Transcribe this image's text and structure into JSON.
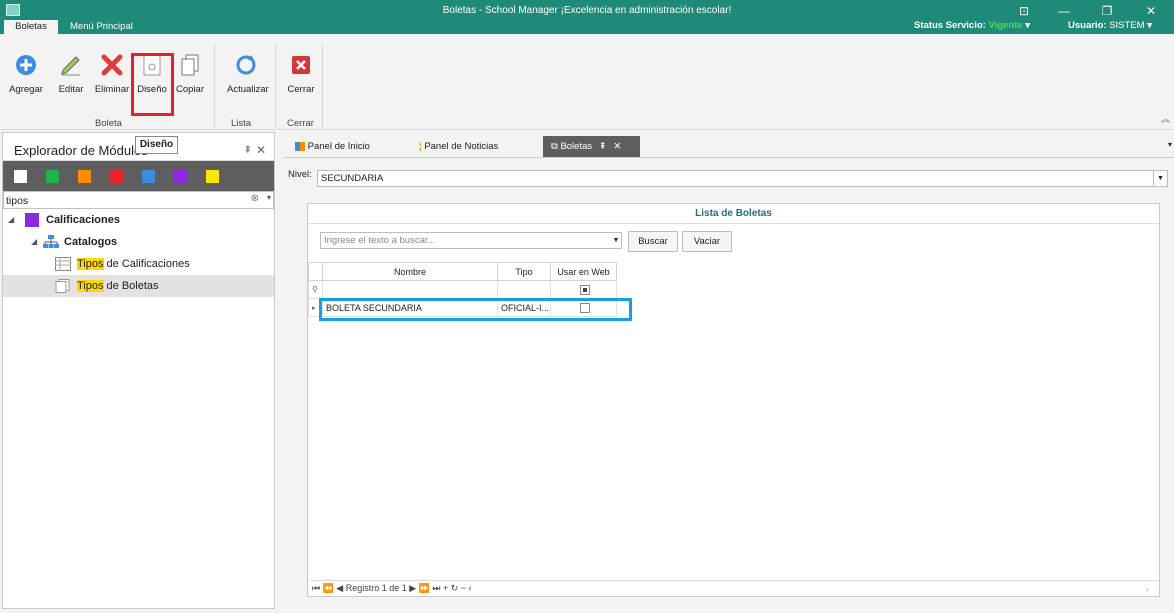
{
  "window": {
    "title": "Boletas - School Manager ¡Excelencia en administración escolar!",
    "tabs": [
      "Boletas",
      "Menú Principal"
    ],
    "status_label": "Status Servicio:",
    "status_value": "Vigente",
    "user_label": "Usuario:",
    "user_value": "SISTEM",
    "btn_restore": "⊡",
    "btn_min": "—",
    "btn_max": "❐",
    "btn_close": "✕"
  },
  "ribbon": {
    "buttons": [
      "Agregar",
      "Editar",
      "Eliminar",
      "Diseño",
      "Copiar",
      "Actualizar",
      "Cerrar"
    ],
    "groups": [
      "Boleta",
      "Lista",
      "Cerrar"
    ],
    "tooltip": "Diseño"
  },
  "explorer": {
    "title": "Explorador de Módulos",
    "colors": [
      "#ffffff",
      "#22b14c",
      "#ff8c00",
      "#e8202a",
      "#3e8ce0",
      "#8a2be2",
      "#ffe600"
    ],
    "search_value": "tipos",
    "tree": {
      "root": "Calificaciones",
      "root_color": "#8a2be2",
      "catalog": "Catalogos",
      "item1_hl": "Tipos",
      "item1_rest": " de Calificaciones",
      "item2_hl": "Tipos",
      "item2_rest": " de Boletas"
    }
  },
  "doc_tabs": [
    "Panel de Inicio",
    "Panel de Noticias",
    "Boletas"
  ],
  "main": {
    "nivel_label": "Nivel:",
    "nivel_value": "SECUNDARIA",
    "grid_title": "Lista de Boletas",
    "search_placeholder": "Ingrese el texto a buscar...",
    "buscar": "Buscar",
    "vaciar": "Vaciar",
    "columns": [
      "Nombre",
      "Tipo",
      "Usar en Web"
    ],
    "rows": [
      {
        "nombre": "BOLETA SECUNDARIA",
        "tipo": "OFICIAL-I...",
        "usar_en_web": false
      }
    ],
    "navigator": "⏮ ⏪ ◀  Registro 1 de 1  ▶ ⏩ ⏭ + ↻ − ‹"
  },
  "colors": {
    "titlebar": "#1f8a78",
    "highlight_red": "#e2222a",
    "highlight_blue": "#17a0e0",
    "search_hl": "#ffd800"
  }
}
